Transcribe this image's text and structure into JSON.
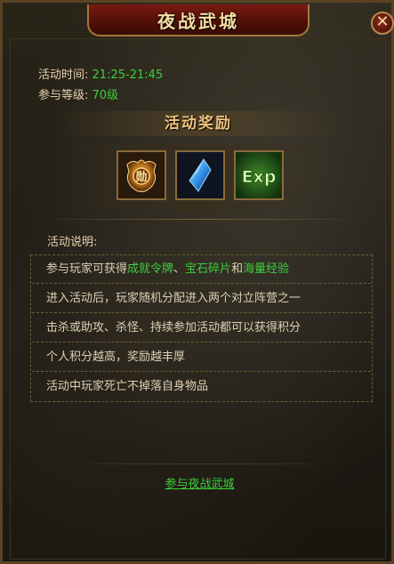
{
  "window": {
    "title": "夜战武城",
    "close_label": "✕"
  },
  "info": {
    "time_label": "活动时间:",
    "time_value": "21:25-21:45",
    "level_label": "参与等级:",
    "level_value": "70级"
  },
  "rewards": {
    "header": "活动奖励",
    "items": [
      {
        "name": "achievement-token",
        "icon": "medal-icon"
      },
      {
        "name": "gem-fragment",
        "icon": "blue-crystal-icon"
      },
      {
        "name": "experience",
        "icon": "exp-icon",
        "label": "Exp"
      }
    ]
  },
  "description": {
    "title": "活动说明:",
    "rows": [
      {
        "parts": [
          {
            "text": "参与玩家可获得",
            "style": "normal"
          },
          {
            "text": "成就令牌",
            "style": "green"
          },
          {
            "text": "、",
            "style": "normal"
          },
          {
            "text": "宝石碎片",
            "style": "green"
          },
          {
            "text": "和",
            "style": "normal"
          },
          {
            "text": "海量经验",
            "style": "green"
          }
        ]
      },
      {
        "parts": [
          {
            "text": "进入活动后，玩家随机分配进入两个对立阵营之一",
            "style": "normal"
          }
        ]
      },
      {
        "parts": [
          {
            "text": "击杀或助攻、杀怪、持续参加活动都可以获得积分",
            "style": "normal"
          }
        ]
      },
      {
        "parts": [
          {
            "text": "个人积分越高，奖励越丰厚",
            "style": "normal"
          }
        ]
      },
      {
        "parts": [
          {
            "text": "活动中玩家死亡不掉落自身物品",
            "style": "normal"
          }
        ]
      }
    ]
  },
  "join_link": "参与夜战武城",
  "colors": {
    "green": "#3ccf3c",
    "gold": "#f0c27a",
    "border": "#8a6a3a"
  }
}
